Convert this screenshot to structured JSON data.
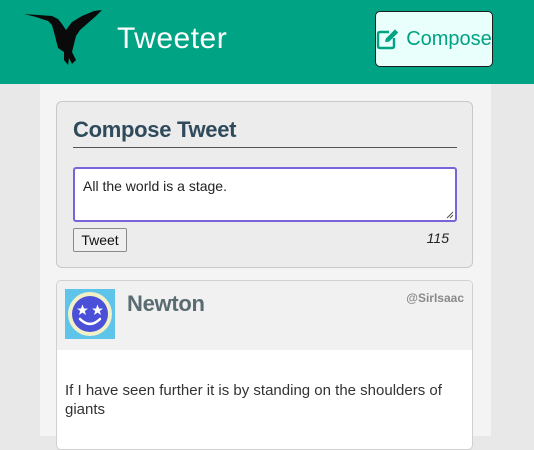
{
  "header": {
    "app_title": "Tweeter",
    "compose_label": "Compose",
    "logo_icon": "hummingbird-icon",
    "compose_icon": "edit-square-icon"
  },
  "compose": {
    "heading": "Compose Tweet",
    "input_value": "All the world is a stage.",
    "tweet_button_label": "Tweet",
    "char_counter": "115"
  },
  "tweets": [
    {
      "author_name": "Newton",
      "handle": "@SirIsaac",
      "avatar_icon": "star-eyes-smiley-icon",
      "text": "If I have seen further it is by standing on the shoulders of giants"
    }
  ],
  "colors": {
    "brand": "#00a383",
    "heading": "#2e4a5b",
    "input_focus": "#7a63d8"
  }
}
